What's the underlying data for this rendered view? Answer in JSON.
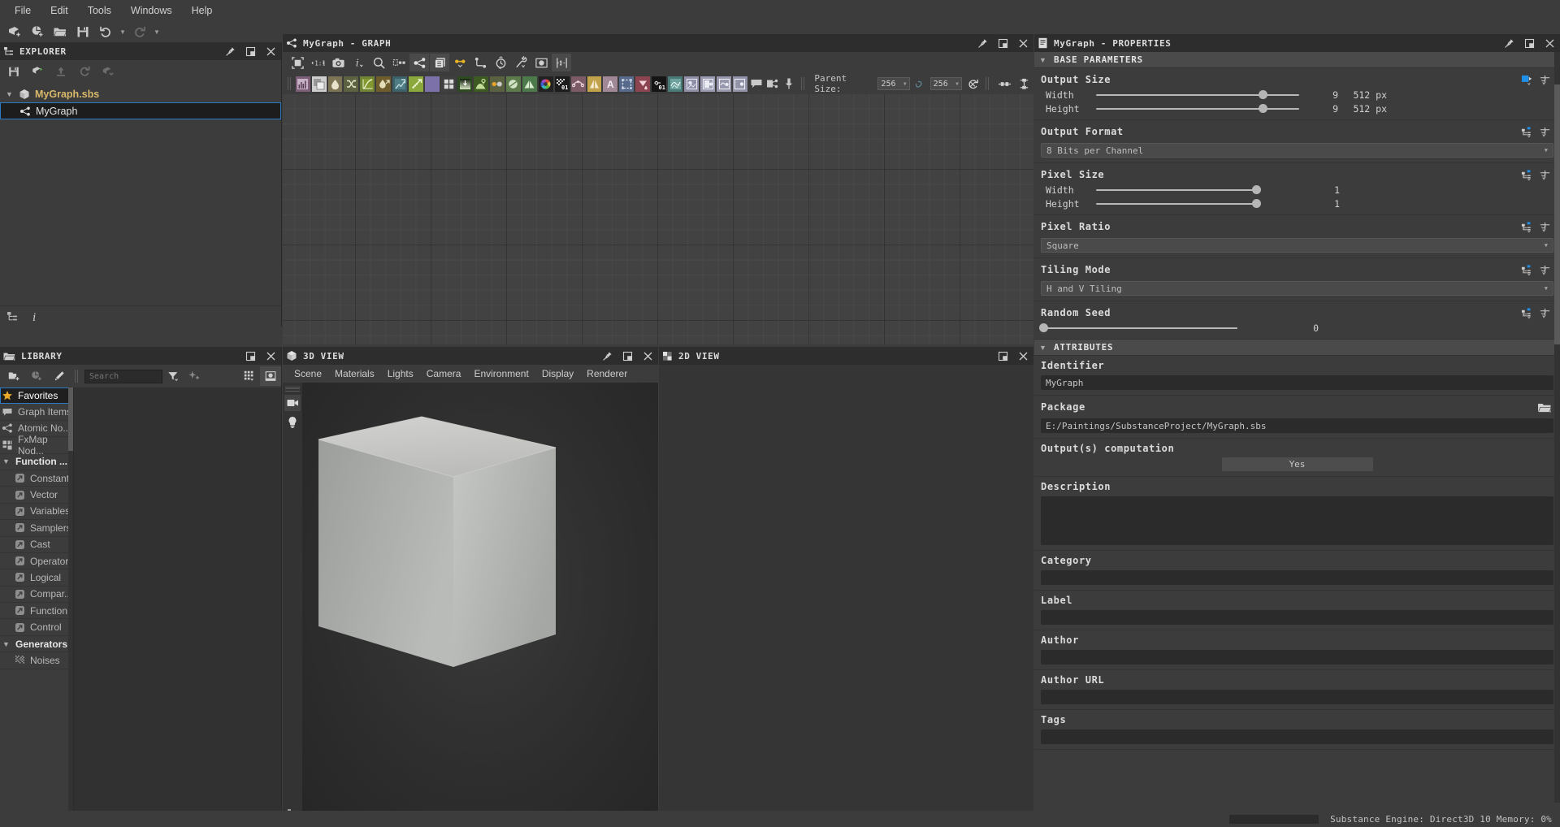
{
  "menubar": {
    "items": [
      {
        "label": "File"
      },
      {
        "label": "Edit"
      },
      {
        "label": "Tools"
      },
      {
        "label": "Windows"
      },
      {
        "label": "Help"
      }
    ]
  },
  "main_toolbar": {
    "buttons": [
      {
        "name": "new-substance-icon"
      },
      {
        "name": "new-package-icon"
      },
      {
        "name": "open-icon"
      },
      {
        "name": "save-icon"
      },
      {
        "name": "undo-icon"
      },
      {
        "name": "redo-icon"
      }
    ]
  },
  "explorer": {
    "title": "EXPLORER",
    "toolbar": [
      "save-icon",
      "publish-icon",
      "upload-icon",
      "reload-icon",
      "link-icon"
    ],
    "tree": [
      {
        "label": "MyGraph.sbs",
        "type": "package",
        "expanded": true,
        "selected": false
      },
      {
        "label": "MyGraph",
        "type": "graph",
        "selected": true
      }
    ],
    "footer_tabs": [
      "explorer-tab-icon",
      "info-tab-icon"
    ]
  },
  "library": {
    "title": "LIBRARY",
    "toolbar_left": [
      "new-folder-icon",
      "new-item-icon",
      "edit-icon"
    ],
    "search": {
      "value": "",
      "placeholder": "Search"
    },
    "filter_icons": [
      "filter-icon",
      "favorite-filter-icon",
      "grid-view-icon",
      "thumbnail-view-icon"
    ],
    "tree": [
      {
        "label": "Favorites",
        "icon": "star-icon",
        "selected": true,
        "level": 0
      },
      {
        "label": "Graph Items",
        "icon": "comment-icon",
        "level": 0
      },
      {
        "label": "Atomic No...",
        "icon": "atomic-icon",
        "level": 0
      },
      {
        "label": "FxMap Nod...",
        "icon": "fxmap-icon",
        "level": 0
      },
      {
        "label": "Function ...",
        "icon": "chevron-down-icon",
        "level": 0,
        "group": true
      },
      {
        "label": "Constant",
        "icon": "function-icon",
        "level": 1
      },
      {
        "label": "Vector",
        "icon": "function-icon",
        "level": 1
      },
      {
        "label": "Variables",
        "icon": "function-icon",
        "level": 1
      },
      {
        "label": "Samplers",
        "icon": "function-icon",
        "level": 1
      },
      {
        "label": "Cast",
        "icon": "function-icon",
        "level": 1
      },
      {
        "label": "Operator",
        "icon": "function-icon",
        "level": 1
      },
      {
        "label": "Logical",
        "icon": "function-icon",
        "level": 1
      },
      {
        "label": "Compar...",
        "icon": "function-icon",
        "level": 1
      },
      {
        "label": "Function",
        "icon": "function-icon",
        "level": 1
      },
      {
        "label": "Control",
        "icon": "function-icon",
        "level": 1
      },
      {
        "label": "Generators",
        "icon": "chevron-down-icon",
        "level": 0,
        "group": true
      },
      {
        "label": "Noises",
        "icon": "noise-icon",
        "level": 1
      }
    ]
  },
  "graph": {
    "title": "MyGraph  -  GRAPH",
    "tools_row1": [
      "fit-view-icon",
      "reset-zoom-icon",
      "screenshot-icon",
      "info-icon",
      "search-icon",
      "align-icon",
      "node-graph-icon",
      "layers-icon",
      "connection-icon",
      "link-node-icon",
      "history-icon",
      "tweak-icon",
      "preview-icon",
      "frame-icon"
    ],
    "node_buttons": [
      "histogram-node",
      "blend-node",
      "blur-node",
      "shuffle-node",
      "curve-node",
      "warp-node",
      "transform-node",
      "gradient-node",
      "circle-node",
      "tile-node",
      "height-node",
      "light-node",
      "dot-node",
      "normal-node",
      "pyramid-node",
      "hsl-node",
      "bitmap-node",
      "spline-node",
      "mirror-node",
      "text-node",
      "selection-node",
      "fill-node",
      "value-node",
      "svg-node",
      "output-node",
      "input-node",
      "function-node",
      "param-node",
      "comment-node",
      "frame-node",
      "pin-node"
    ],
    "parent_size": {
      "label": "Parent Size:",
      "width": "256",
      "height": "256",
      "reset_icon": "reset-icon",
      "link_icon": "chain-icon"
    },
    "right_icons": [
      "connect-icon",
      "dependency-icon"
    ]
  },
  "view3d": {
    "title": "3D VIEW",
    "menu": [
      "Scene",
      "Materials",
      "Lights",
      "Camera",
      "Environment",
      "Display",
      "Renderer"
    ],
    "rail": [
      "camera-icon",
      "light-icon",
      "settings-icon"
    ]
  },
  "view2d": {
    "title": "2D VIEW"
  },
  "properties": {
    "title": "MyGraph  -  PROPERTIES",
    "sections": {
      "base_parameters": {
        "label": "BASE PARAMETERS",
        "output_size": {
          "label": "Output Size",
          "width": {
            "label": "Width",
            "exp": "9",
            "px": "512 px",
            "pos": 82
          },
          "height": {
            "label": "Height",
            "exp": "9",
            "px": "512 px",
            "pos": 82
          }
        },
        "output_format": {
          "label": "Output Format",
          "value": "8 Bits per Channel"
        },
        "pixel_size": {
          "label": "Pixel Size",
          "width": {
            "label": "Width",
            "value": "1",
            "pos": 100
          },
          "height": {
            "label": "Height",
            "value": "1",
            "pos": 100
          }
        },
        "pixel_ratio": {
          "label": "Pixel Ratio",
          "value": "Square"
        },
        "tiling_mode": {
          "label": "Tiling Mode",
          "value": "H and V Tiling"
        },
        "random_seed": {
          "label": "Random Seed",
          "value": "0",
          "pos": 0
        }
      },
      "attributes": {
        "label": "ATTRIBUTES",
        "identifier": {
          "label": "Identifier",
          "value": "MyGraph"
        },
        "package": {
          "label": "Package",
          "value": "E:/Paintings/SubstanceProject/MyGraph.sbs",
          "icon": "folder-icon"
        },
        "outputs_computation": {
          "label": "Output(s) computation",
          "value": "Yes"
        },
        "description": {
          "label": "Description",
          "value": ""
        },
        "category": {
          "label": "Category",
          "value": ""
        },
        "label_field": {
          "label": "Label",
          "value": ""
        },
        "author": {
          "label": "Author",
          "value": ""
        },
        "author_url": {
          "label": "Author URL",
          "value": ""
        },
        "tags": {
          "label": "Tags",
          "value": ""
        }
      }
    }
  },
  "statusbar": {
    "text": "Substance Engine: Direct3D 10 Memory: 0%"
  },
  "colors": {
    "accent_blue": "#2d7ac4",
    "panel_bg": "#3c3c3c",
    "title_bg": "#2d2d2d",
    "canvas_bg": "#424242",
    "star_gold": "#e8a92a",
    "package_gold": "#d8b86a"
  }
}
